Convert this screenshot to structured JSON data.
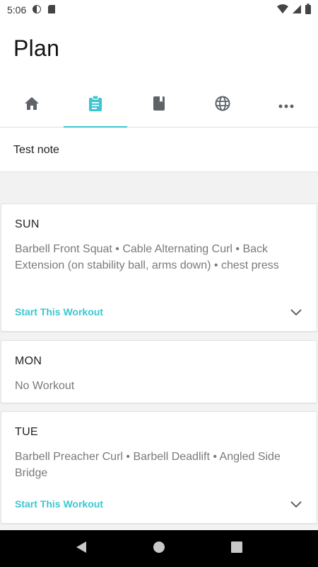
{
  "status_bar": {
    "time": "5:06",
    "icons": [
      "circle-half-icon",
      "sd-card-icon",
      "wifi-icon",
      "signal-icon",
      "battery-icon"
    ]
  },
  "page": {
    "title": "Plan"
  },
  "tabs": [
    {
      "icon": "home-icon",
      "active": false
    },
    {
      "icon": "clipboard-icon",
      "active": true
    },
    {
      "icon": "book-icon",
      "active": false
    },
    {
      "icon": "globe-icon",
      "active": false
    },
    {
      "icon": "more-icon",
      "active": false
    }
  ],
  "note": {
    "text": "Test note"
  },
  "days": [
    {
      "day": "SUN",
      "exercises": "Barbell Front Squat • Cable Alternating Curl • Back Extension (on stability ball, arms down) • chest press",
      "action": "Start This Workout"
    },
    {
      "day": "MON",
      "exercises": "No Workout"
    },
    {
      "day": "TUE",
      "exercises": "Barbell Preacher Curl • Barbell Deadlift • Angled Side Bridge",
      "action": "Start This Workout"
    }
  ],
  "colors": {
    "accent": "#3cc6d0",
    "icon_gray": "#5f6368",
    "background_gray": "#f2f2f2"
  }
}
